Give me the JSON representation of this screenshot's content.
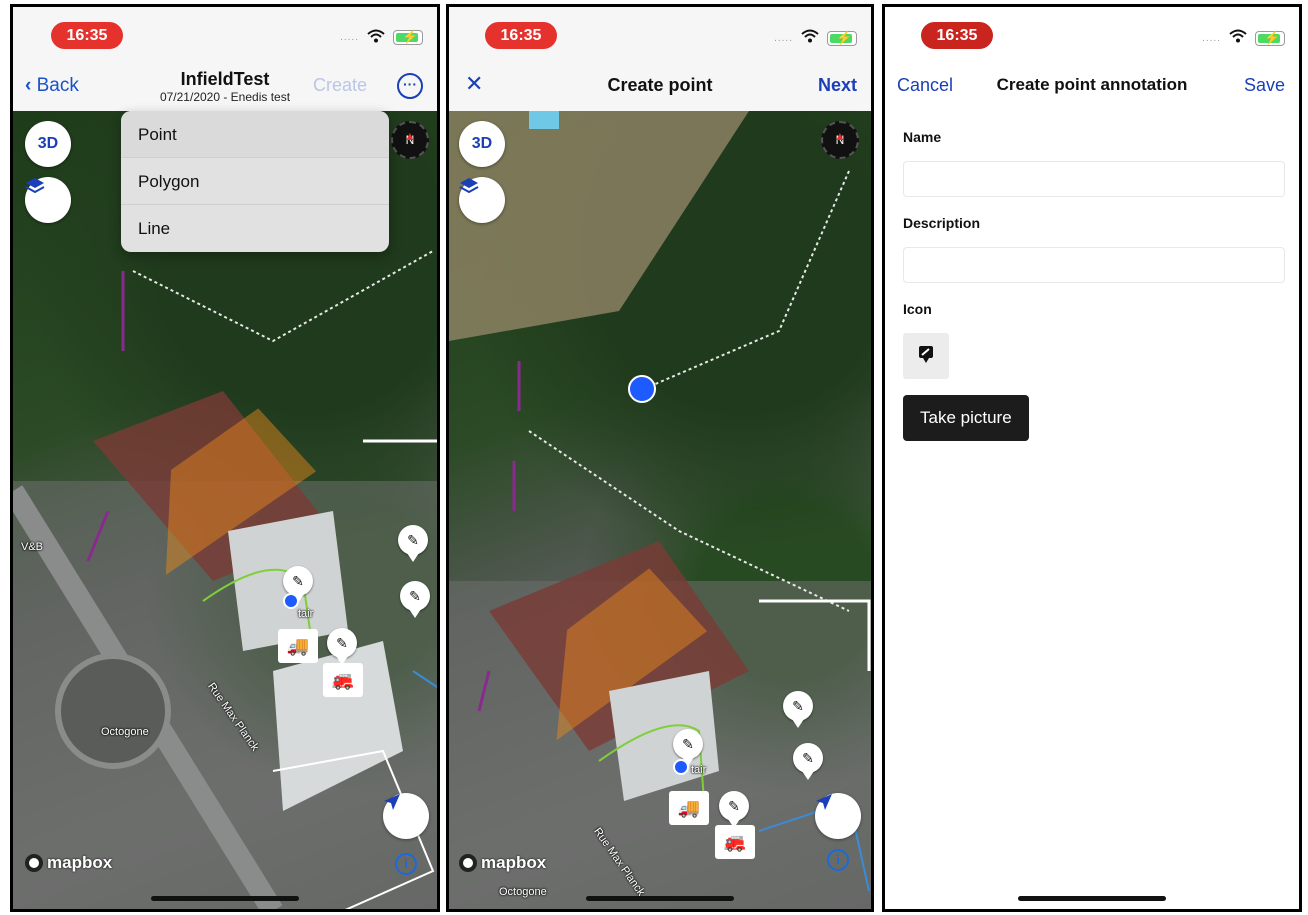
{
  "status": {
    "time": "16:35",
    "signal_dots": "....."
  },
  "screen1": {
    "nav": {
      "back_label": "Back",
      "title": "InfieldTest",
      "subtitle": "07/21/2020 - Enedis test",
      "create_label": "Create"
    },
    "menu": {
      "items": [
        {
          "label": "Point"
        },
        {
          "label": "Polygon"
        },
        {
          "label": "Line"
        }
      ]
    },
    "map": {
      "btn_3d": "3D",
      "mapbox": "mapbox",
      "labels": {
        "vb": "V&B",
        "octogone": "Octogone",
        "street": "Rue Max Planck",
        "tair": "tair"
      }
    }
  },
  "screen2": {
    "nav": {
      "close_label": "✕",
      "title": "Create point",
      "next_label": "Next"
    },
    "map": {
      "btn_3d": "3D",
      "mapbox": "mapbox",
      "labels": {
        "octogone": "Octogone",
        "street": "Rue Max Planck",
        "tair": "tair"
      }
    }
  },
  "screen3": {
    "nav": {
      "cancel_label": "Cancel",
      "title": "Create point annotation",
      "save_label": "Save"
    },
    "form": {
      "name_label": "Name",
      "name_value": "",
      "description_label": "Description",
      "description_value": "",
      "icon_label": "Icon",
      "take_picture_label": "Take picture"
    }
  },
  "colors": {
    "accent": "#1a52c9",
    "polygon": "#f08c1a",
    "time_pill": "#e5322d",
    "point": "#1e5bff"
  },
  "icons": {
    "point_icon": "note-pin-icon",
    "truck": "truck-icon",
    "firetruck": "fire-truck-icon"
  }
}
